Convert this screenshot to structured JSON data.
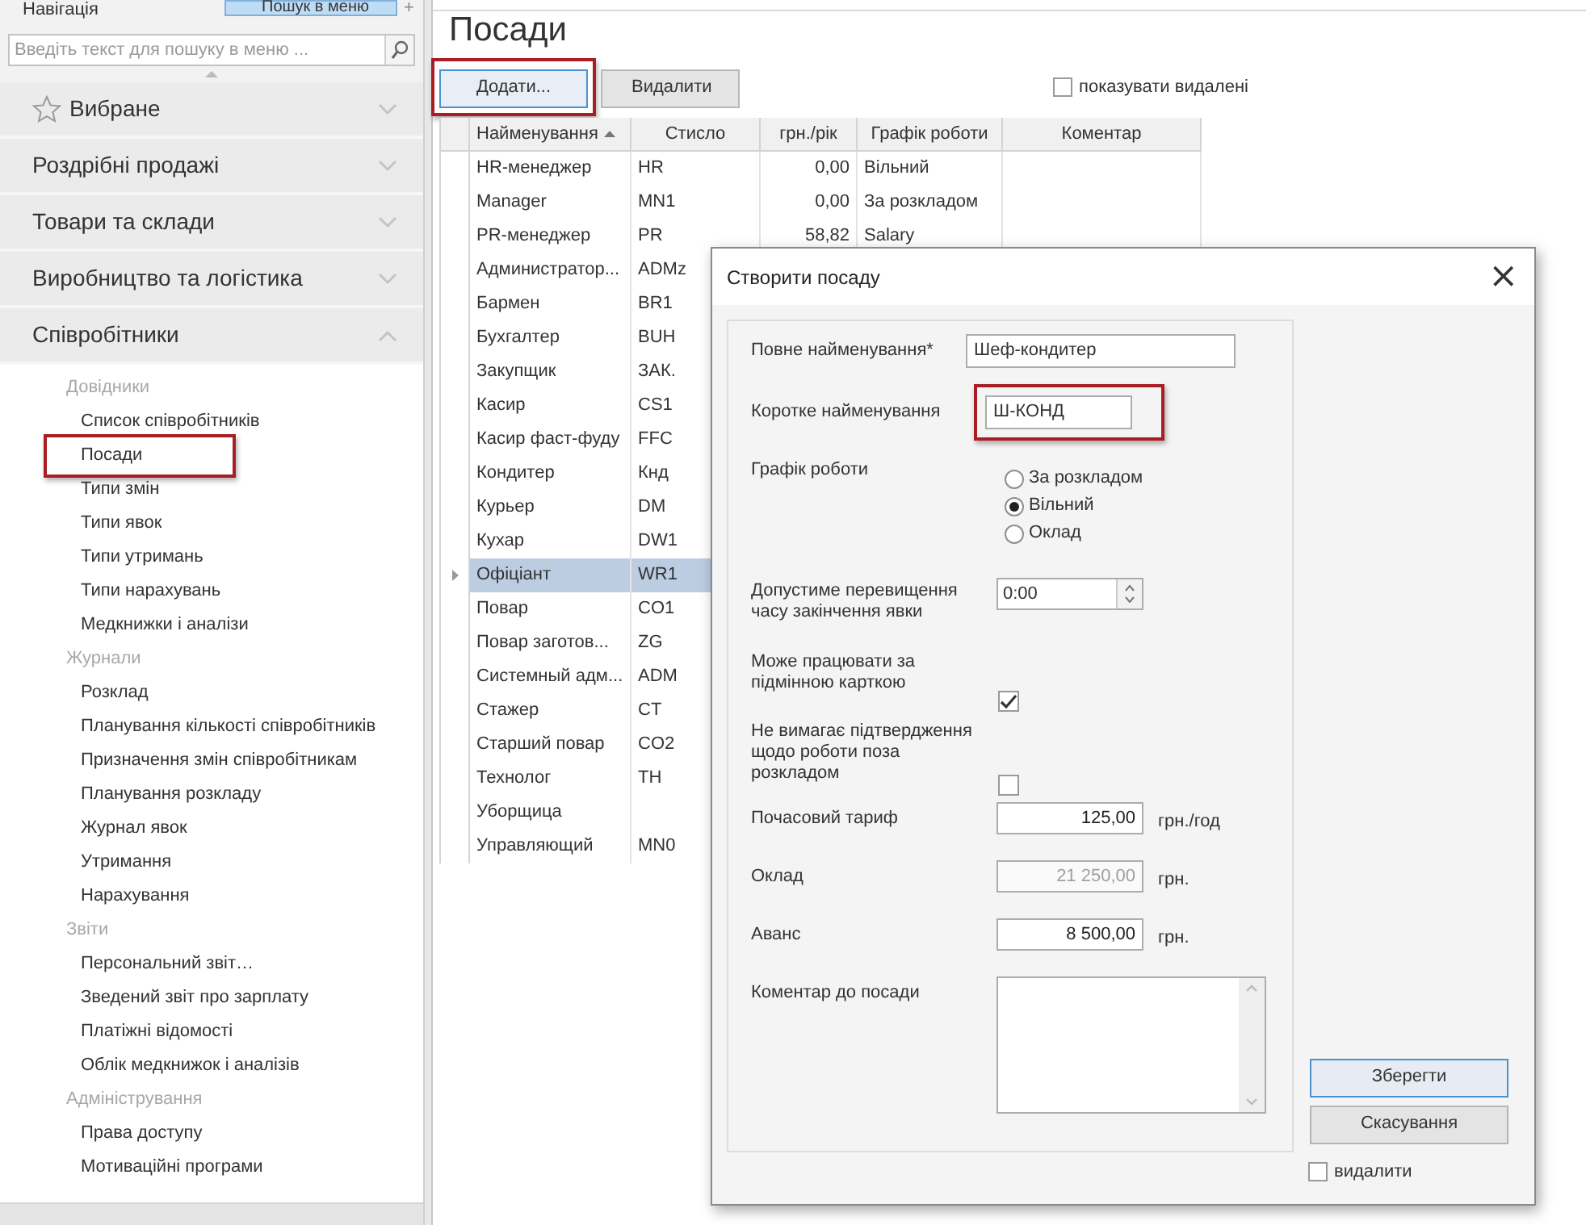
{
  "navigation": {
    "title": "Навігація",
    "search_button": "Пошук в меню",
    "add_button": "+",
    "search": {
      "placeholder": "Введіть текст для пошуку в меню ..."
    },
    "sections": [
      {
        "label": "Вибране",
        "kind": "favorites",
        "expanded": false
      },
      {
        "label": "Роздрібні продажі",
        "kind": "plain",
        "expanded": false
      },
      {
        "label": "Товари та склади",
        "kind": "plain",
        "expanded": false
      },
      {
        "label": "Виробництво та логістика",
        "kind": "plain",
        "expanded": false
      },
      {
        "label": "Співробітники",
        "kind": "plain",
        "expanded": true
      }
    ],
    "groups": [
      {
        "label": "Довідники",
        "items": [
          {
            "label": "Список співробітників",
            "highlighted": false
          },
          {
            "label": "Посади",
            "highlighted": true
          },
          {
            "label": "Типи змін",
            "highlighted": false
          },
          {
            "label": "Типи явок",
            "highlighted": false
          },
          {
            "label": "Типи утримань",
            "highlighted": false
          },
          {
            "label": "Типи нарахувань",
            "highlighted": false
          },
          {
            "label": "Медкнижки і аналізи",
            "highlighted": false
          }
        ]
      },
      {
        "label": "Журнали",
        "items": [
          {
            "label": "Розклад",
            "highlighted": false
          },
          {
            "label": "Планування кількості співробітників",
            "highlighted": false
          },
          {
            "label": "Призначення змін співробітникам",
            "highlighted": false
          },
          {
            "label": "Планування розкладу",
            "highlighted": false
          },
          {
            "label": "Журнал явок",
            "highlighted": false
          },
          {
            "label": "Утримання",
            "highlighted": false
          },
          {
            "label": "Нарахування",
            "highlighted": false
          }
        ]
      },
      {
        "label": "Звіти",
        "items": [
          {
            "label": "Персональний звіт…",
            "highlighted": false
          },
          {
            "label": "Зведений звіт про зарплату",
            "highlighted": false
          },
          {
            "label": "Платіжні відомості",
            "highlighted": false
          },
          {
            "label": "Облік медкнижок і аналізів",
            "highlighted": false
          }
        ]
      },
      {
        "label": "Адміністрування",
        "items": [
          {
            "label": "Права доступу",
            "highlighted": false
          },
          {
            "label": "Мотиваційні програми",
            "highlighted": false
          }
        ]
      }
    ]
  },
  "page": {
    "title": "Посади",
    "buttons": [
      {
        "label": "Додати...",
        "focused": true,
        "highlighted": true
      },
      {
        "label": "Видалити",
        "focused": false,
        "highlighted": false
      }
    ],
    "show_deleted": {
      "label": "показувати видалені",
      "checked": false
    }
  },
  "table": {
    "columns": [
      {
        "label": "Найменування",
        "sorted": true
      },
      {
        "label": "Стисло",
        "sorted": false
      },
      {
        "label": "грн./рік",
        "sorted": false
      },
      {
        "label": "Графік роботи",
        "sorted": false
      },
      {
        "label": "Коментар",
        "sorted": false
      }
    ],
    "rows": [
      {
        "cells": [
          "HR-менеджер",
          "HR",
          "0,00",
          "Вільний"
        ],
        "selected": false
      },
      {
        "cells": [
          "Manager",
          "MN1",
          "0,00",
          "За розкладом"
        ],
        "selected": false
      },
      {
        "cells": [
          "PR-менеджер",
          "PR",
          "58,82",
          "Salary"
        ],
        "selected": false
      },
      {
        "cells": [
          "Администратор...",
          "ADMz"
        ],
        "selected": false
      },
      {
        "cells": [
          "Бармен",
          "BR1"
        ],
        "selected": false
      },
      {
        "cells": [
          "Бухгалтер",
          "BUH"
        ],
        "selected": false
      },
      {
        "cells": [
          "Закупщик",
          "ЗАК."
        ],
        "selected": false
      },
      {
        "cells": [
          "Касир",
          "CS1"
        ],
        "selected": false
      },
      {
        "cells": [
          "Касир фаст-фуду",
          "FFC"
        ],
        "selected": false
      },
      {
        "cells": [
          "Кондитер",
          "Кнд"
        ],
        "selected": false
      },
      {
        "cells": [
          "Курьер",
          "DM"
        ],
        "selected": false
      },
      {
        "cells": [
          "Кухар",
          "DW1"
        ],
        "selected": false
      },
      {
        "cells": [
          "Офіціант",
          "WR1"
        ],
        "selected": true
      },
      {
        "cells": [
          "Повар",
          "CO1"
        ],
        "selected": false
      },
      {
        "cells": [
          "Повар заготов...",
          "ZG"
        ],
        "selected": false
      },
      {
        "cells": [
          "Системный адм...",
          "ADM"
        ],
        "selected": false
      },
      {
        "cells": [
          "Стажер",
          "CT"
        ],
        "selected": false
      },
      {
        "cells": [
          "Старший повар",
          "CO2"
        ],
        "selected": false
      },
      {
        "cells": [
          "Технолог",
          "TH"
        ],
        "selected": false
      },
      {
        "cells": [
          "Уборщица"
        ],
        "selected": false
      },
      {
        "cells": [
          "Управляющий",
          "MN0"
        ],
        "selected": false
      }
    ]
  },
  "dialog": {
    "title": "Створити посаду",
    "close": "×",
    "fields": [
      {
        "kind": "text",
        "label": "Повне найменування*",
        "value": "Шеф-кондитер",
        "highlighted": false
      },
      {
        "kind": "short",
        "label": "Коротке найменування",
        "value": "Ш-КОНД",
        "highlighted": true
      },
      {
        "kind": "radio",
        "label": "Графік роботи",
        "options": [
          {
            "label": "За розкладом",
            "selected": false
          },
          {
            "label": "Вільний",
            "selected": true
          },
          {
            "label": "Оклад",
            "selected": false
          }
        ]
      },
      {
        "kind": "spinner",
        "label": "Допустиме перевищення часу закінчення явки",
        "value": "0:00"
      },
      {
        "kind": "checkbox",
        "label": "Може працювати за підмінною карткою",
        "checked": true
      },
      {
        "kind": "checkbox",
        "label": "Не вимагає підтвердження щодо роботи поза розкладом",
        "checked": false
      },
      {
        "kind": "money",
        "label": "Почасовий тариф",
        "value": "125,00",
        "unit": "грн./год",
        "disabled": false
      },
      {
        "kind": "money",
        "label": "Оклад",
        "value": "21 250,00",
        "unit": "грн.",
        "disabled": true
      },
      {
        "kind": "money",
        "label": "Аванс",
        "value": "8 500,00",
        "unit": "грн.",
        "disabled": false
      },
      {
        "kind": "textarea",
        "label": "Коментар до посади"
      }
    ],
    "buttons": [
      {
        "label": "Зберегти",
        "focused": true
      },
      {
        "label": "Скасування",
        "focused": false
      }
    ],
    "delete": {
      "label": "видалити",
      "checked": false
    }
  }
}
